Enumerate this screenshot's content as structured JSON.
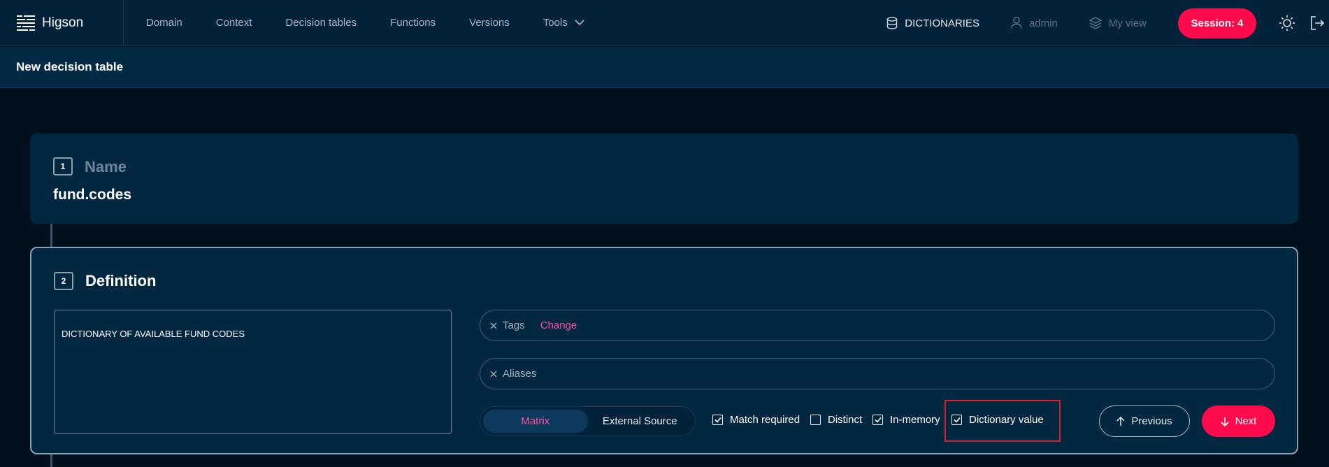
{
  "app": {
    "name": "Higson"
  },
  "nav": {
    "items": [
      "Domain",
      "Context",
      "Decision tables",
      "Functions",
      "Versions",
      "Tools"
    ]
  },
  "right_nav": {
    "dictionaries": "DICTIONARIES",
    "user": "admin",
    "my_view": "My view",
    "session": "Session: 4"
  },
  "page": {
    "title": "New decision table"
  },
  "steps": {
    "name": {
      "number": "1",
      "title": "Name",
      "value": "fund.codes"
    },
    "definition": {
      "number": "2",
      "title": "Definition",
      "description": "DICTIONARY OF AVAILABLE FUND CODES",
      "tags_label": "Tags",
      "tags_action": "Change",
      "aliases_label": "Aliases",
      "source_options": [
        "Matrix",
        "External Source"
      ],
      "source_selected": "Matrix",
      "checkboxes": [
        {
          "label": "Match required",
          "checked": true
        },
        {
          "label": "Distinct",
          "checked": false
        },
        {
          "label": "In-memory",
          "checked": true
        },
        {
          "label": "Dictionary value",
          "checked": true
        }
      ],
      "previous_label": "Previous",
      "next_label": "Next"
    }
  },
  "colors": {
    "accent": "#ff0a4a",
    "link": "#ff4fa0",
    "background": "#020f1c",
    "panel": "#022741",
    "highlight": "#e01b2e"
  },
  "icons": [
    "menu-logo-icon",
    "chevron-down-icon",
    "database-icon",
    "user-icon",
    "layers-icon",
    "sun-icon",
    "logout-icon",
    "close-icon",
    "check-icon",
    "arrow-up-icon",
    "arrow-down-icon"
  ]
}
